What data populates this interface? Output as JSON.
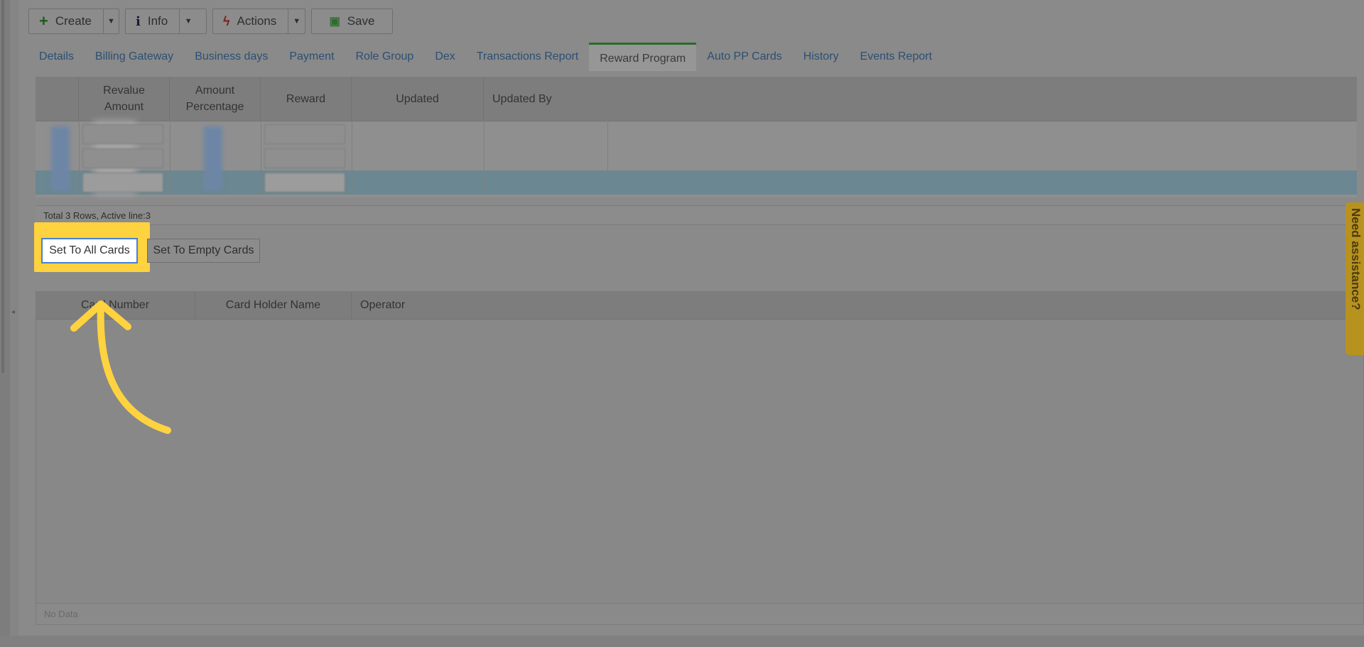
{
  "toolbar": {
    "create_label": "Create",
    "info_label": "Info",
    "actions_label": "Actions",
    "save_label": "Save"
  },
  "tabs": [
    {
      "label": "Details"
    },
    {
      "label": "Billing Gateway"
    },
    {
      "label": "Business days"
    },
    {
      "label": "Payment"
    },
    {
      "label": "Role Group"
    },
    {
      "label": "Dex"
    },
    {
      "label": "Transactions Report"
    },
    {
      "label": "Reward Program",
      "active": true
    },
    {
      "label": "Auto PP Cards"
    },
    {
      "label": "History"
    },
    {
      "label": "Events Report"
    }
  ],
  "reward_grid": {
    "columns": {
      "revalue_amount_l1": "Revalue",
      "revalue_amount_l2": "Amount",
      "amount_percentage_l1": "Amount",
      "amount_percentage_l2": "Percentage",
      "reward": "Reward",
      "updated": "Updated",
      "updated_by": "Updated By"
    },
    "status": "Total 3 Rows, Active line:3"
  },
  "actions": {
    "set_all": "Set To All Cards",
    "set_empty": "Set To Empty Cards"
  },
  "cards_grid": {
    "columns": {
      "card_number": "Card Number",
      "card_holder": "Card Holder Name",
      "operator": "Operator"
    },
    "status": "No Data"
  },
  "assist_tab": "Need assistance?",
  "colors": {
    "highlight": "#ffd23f",
    "tab_active_border": "#2a6b2a",
    "link": "#2c4f73"
  }
}
